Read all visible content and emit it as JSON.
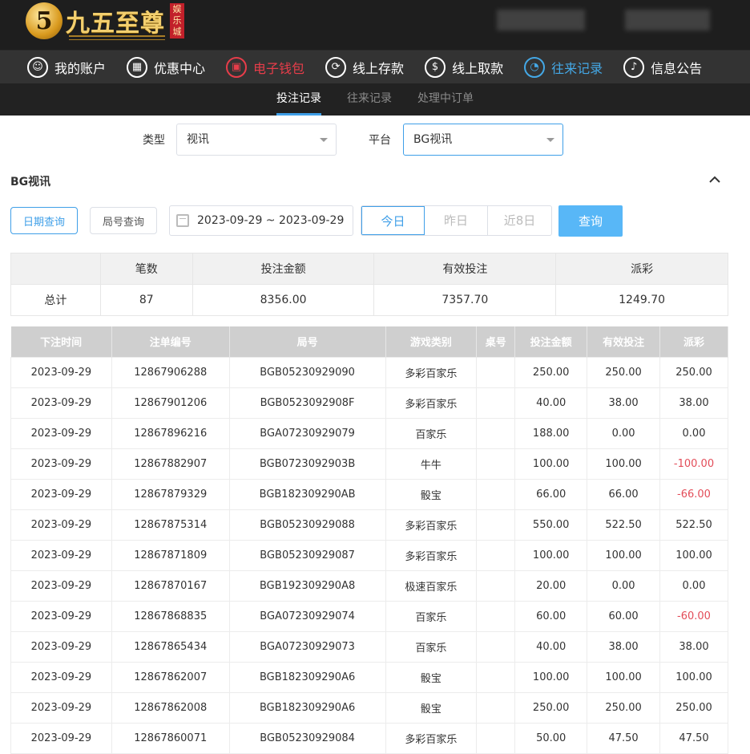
{
  "brand": {
    "logo_char": "5",
    "name": "九五至尊",
    "sub": "娱乐城"
  },
  "main_nav": [
    {
      "label": "我的账户",
      "icon": "user-icon",
      "glyph": "☺",
      "state": ""
    },
    {
      "label": "优惠中心",
      "icon": "gift-icon",
      "glyph": "▦",
      "state": ""
    },
    {
      "label": "电子钱包",
      "icon": "wallet-icon",
      "glyph": "▣",
      "state": "active-red"
    },
    {
      "label": "线上存款",
      "icon": "deposit-icon",
      "glyph": "⟳",
      "state": ""
    },
    {
      "label": "线上取款",
      "icon": "withdraw-icon",
      "glyph": "$",
      "state": ""
    },
    {
      "label": "往来记录",
      "icon": "records-icon",
      "glyph": "◔",
      "state": "active-blue"
    },
    {
      "label": "信息公告",
      "icon": "bell-icon",
      "glyph": "♪",
      "state": ""
    }
  ],
  "sub_nav": [
    {
      "label": "投注记录",
      "active": true
    },
    {
      "label": "往来记录",
      "active": false
    },
    {
      "label": "处理中订单",
      "active": false
    }
  ],
  "filters": {
    "type_label": "类型",
    "type_value": "视讯",
    "platform_label": "平台",
    "platform_value": "BG视讯"
  },
  "section_title": "BG视讯",
  "query": {
    "date_query": "日期查询",
    "round_query": "局号查询",
    "date_range": "2023-09-29 ~ 2023-09-29",
    "today": "今日",
    "yesterday": "昨日",
    "last8": "近8日",
    "submit": "查询"
  },
  "summary": {
    "headers": [
      "",
      "笔数",
      "投注金额",
      "有效投注",
      "派彩"
    ],
    "row": [
      "总计",
      "87",
      "8356.00",
      "7357.70",
      "1249.70"
    ]
  },
  "records": {
    "headers": [
      "下注时间",
      "注单编号",
      "局号",
      "游戏类别",
      "桌号",
      "投注金额",
      "有效投注",
      "派彩"
    ],
    "rows": [
      [
        "2023-09-29",
        "12867906288",
        "BGB05230929090",
        "多彩百家乐",
        "",
        "250.00",
        "250.00",
        "250.00"
      ],
      [
        "2023-09-29",
        "12867901206",
        "BGB0523092908F",
        "多彩百家乐",
        "",
        "40.00",
        "38.00",
        "38.00"
      ],
      [
        "2023-09-29",
        "12867896216",
        "BGA07230929079",
        "百家乐",
        "",
        "188.00",
        "0.00",
        "0.00"
      ],
      [
        "2023-09-29",
        "12867882907",
        "BGB0723092903B",
        "牛牛",
        "",
        "100.00",
        "100.00",
        "-100.00"
      ],
      [
        "2023-09-29",
        "12867879329",
        "BGB182309290AB",
        "骰宝",
        "",
        "66.00",
        "66.00",
        "-66.00"
      ],
      [
        "2023-09-29",
        "12867875314",
        "BGB05230929088",
        "多彩百家乐",
        "",
        "550.00",
        "522.50",
        "522.50"
      ],
      [
        "2023-09-29",
        "12867871809",
        "BGB05230929087",
        "多彩百家乐",
        "",
        "100.00",
        "100.00",
        "100.00"
      ],
      [
        "2023-09-29",
        "12867870167",
        "BGB192309290A8",
        "极速百家乐",
        "",
        "20.00",
        "0.00",
        "0.00"
      ],
      [
        "2023-09-29",
        "12867868835",
        "BGA07230929074",
        "百家乐",
        "",
        "60.00",
        "60.00",
        "-60.00"
      ],
      [
        "2023-09-29",
        "12867865434",
        "BGA07230929073",
        "百家乐",
        "",
        "40.00",
        "38.00",
        "38.00"
      ],
      [
        "2023-09-29",
        "12867862007",
        "BGB182309290A6",
        "骰宝",
        "",
        "100.00",
        "100.00",
        "100.00"
      ],
      [
        "2023-09-29",
        "12867862008",
        "BGB182309290A6",
        "骰宝",
        "",
        "250.00",
        "250.00",
        "250.00"
      ],
      [
        "2023-09-29",
        "12867860071",
        "BGB05230929084",
        "多彩百家乐",
        "",
        "50.00",
        "47.50",
        "47.50"
      ]
    ]
  },
  "colors": {
    "accent": "#3f9fe8",
    "negative": "#e34d59",
    "wallet": "#e73d4a"
  }
}
